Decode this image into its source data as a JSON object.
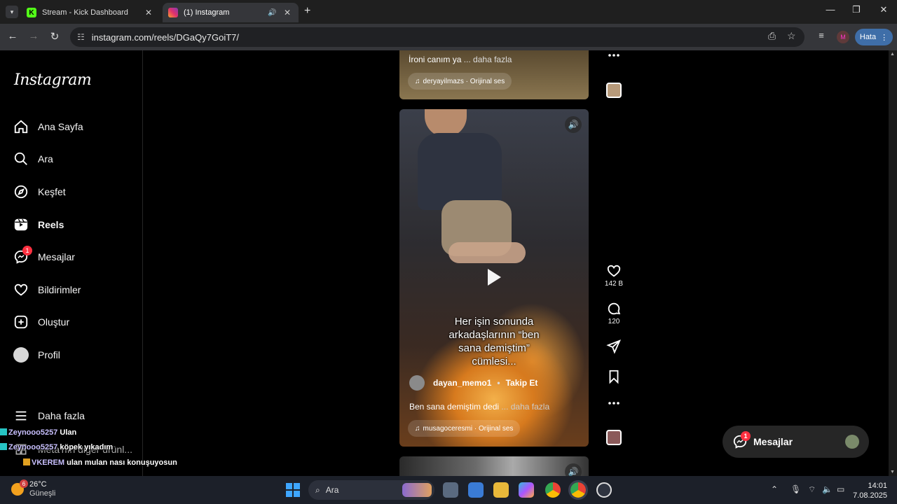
{
  "browser": {
    "tabs": [
      {
        "title": "Stream - Kick Dashboard",
        "favicon": "K"
      },
      {
        "title": "(1) Instagram",
        "favicon": "ig"
      }
    ],
    "url": "instagram.com/reels/DGaQy7GoiT7/",
    "profile_initial": "M",
    "error_label": "Hata"
  },
  "sidebar": {
    "logo": "Instagram",
    "items": [
      {
        "label": "Ana Sayfa",
        "icon": "home-icon"
      },
      {
        "label": "Ara",
        "icon": "search-icon"
      },
      {
        "label": "Keşfet",
        "icon": "compass-icon"
      },
      {
        "label": "Reels",
        "icon": "reels-icon"
      },
      {
        "label": "Mesajlar",
        "icon": "messenger-icon",
        "badge": "1"
      },
      {
        "label": "Bildirimler",
        "icon": "heart-icon"
      },
      {
        "label": "Oluştur",
        "icon": "plus-square-icon"
      },
      {
        "label": "Profil",
        "icon": "avatar"
      },
      {
        "label": "Daha fazla",
        "icon": "menu-icon"
      },
      {
        "label": "Meta'nın diğer ürünl...",
        "icon": "meta-icon"
      }
    ]
  },
  "previous_reel": {
    "caption": "İroni canım ya",
    "more": "... daha fazla",
    "audio": "deryayilmazs · Orijinal ses"
  },
  "reel": {
    "overlay_text": [
      "Her işin sonunda",
      "arkadaşlarının “ben",
      "sana demiştim”",
      "cümlesi..."
    ],
    "author": "dayan_memo1",
    "separator": "•",
    "follow": "Takip Et",
    "caption": "Ben sana demiştim dedi",
    "more": "... daha fazla",
    "audio": "musagoceresmi · Orijinal ses",
    "likes": "142 B",
    "comments": "120"
  },
  "messages_pill": {
    "label": "Mesajlar",
    "badge": "1"
  },
  "chat_overlay": [
    {
      "user": "Zeynooo5257",
      "message": "Ulan"
    },
    {
      "user": "Zeynooo5257",
      "message": "köpek yıkadım"
    },
    {
      "user": "VKEREM",
      "message": "ulan mulan nası konuşuyosun"
    }
  ],
  "taskbar": {
    "weather_temp": "26°C",
    "weather_desc": "Güneşli",
    "weather_badge": "6",
    "search_label": "Ara",
    "time": "14:01",
    "date": "7.08.2025"
  },
  "colors": {
    "accent_badge": "#ff3040",
    "pill_blue": "#3f6ea8"
  }
}
